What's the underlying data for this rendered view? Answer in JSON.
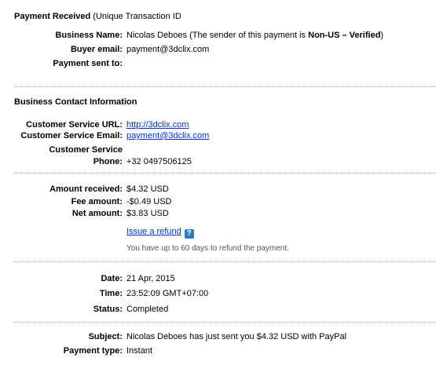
{
  "payment_header": {
    "title": "Payment Received",
    "subtitle": "(Unique Transaction ID"
  },
  "buyer": {
    "business_name_label": "Business Name:",
    "business_name_value": "Nicolas Deboes (The sender of this payment is",
    "business_name_status": "Non-US – Verified",
    "business_name_close": ")",
    "buyer_email_label": "Buyer email:",
    "buyer_email_value": "payment@3dclix.com",
    "payment_sent_to_label": "Payment sent to:"
  },
  "contact": {
    "section_title": "Business Contact Information",
    "url_label": "Customer Service URL:",
    "url_value": "http://3dclix.com",
    "email_label": "Customer Service Email:",
    "email_value": "payment@3dclix.com",
    "phone_label_line1": "Customer Service",
    "phone_label_line2": "Phone:",
    "phone_value": "+32 0497506125"
  },
  "amounts": {
    "received_label": "Amount received:",
    "received_value": "$4.32 USD",
    "fee_label": "Fee amount:",
    "fee_value": "-$0.49 USD",
    "net_label": "Net amount:",
    "net_value": "$3.83 USD",
    "refund_link": "Issue a refund",
    "help_glyph": "?",
    "refund_note": "You have up to 60 days to refund the payment."
  },
  "details": {
    "date_label": "Date:",
    "date_value": "21 Apr, 2015",
    "time_label": "Time:",
    "time_value": "23:52:09 GMT+07:00",
    "status_label": "Status:",
    "status_value": "Completed"
  },
  "message": {
    "subject_label": "Subject:",
    "subject_value": "Nicolas Deboes has just sent you $4.32 USD with PayPal",
    "type_label": "Payment type:",
    "type_value": "Instant"
  },
  "colors": {
    "link": "#0033cc",
    "help_icon_bg": "#2e7cc4",
    "separator": "#9a9a9a"
  }
}
